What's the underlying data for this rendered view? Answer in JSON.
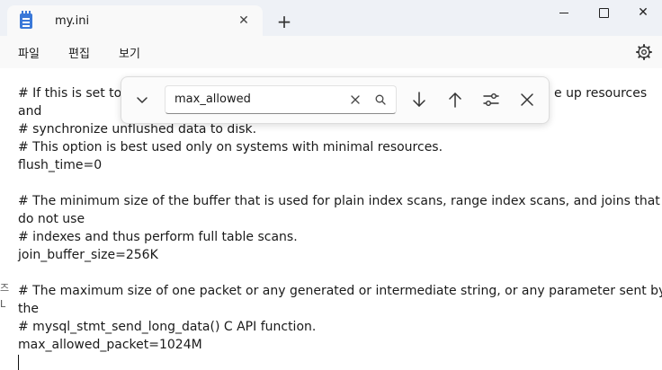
{
  "tab": {
    "title": "my.ini",
    "close_glyph": "✕"
  },
  "window": {
    "new_tab_glyph": "+",
    "close_glyph": "✕"
  },
  "menu": {
    "file": "파일",
    "edit": "편집",
    "view": "보기"
  },
  "find": {
    "query": "max_allowed"
  },
  "editor": {
    "lines": [
      "# If this is set to",
      "e up resources",
      "and",
      "# synchronize unflushed data to disk.",
      "# This option is best used only on systems with minimal resources.",
      "flush_time=0",
      "",
      "# The minimum size of the buffer that is used for plain index scans, range index scans, and joins that",
      "do not use",
      "# indexes and thus perform full table scans.",
      "join_buffer_size=256K",
      "",
      "# The maximum size of one packet or any generated or intermediate string, or any parameter sent by",
      "the",
      "# mysql_stmt_send_long_data() C API function.",
      "max_allowed_packet=1024M"
    ],
    "edge_fragments": [
      "즈",
      "L"
    ]
  },
  "icons": {
    "app": "notepad-icon",
    "settings": "gear-icon",
    "collapse": "chevron-down-icon",
    "clear": "close-icon",
    "search": "search-icon",
    "next": "arrow-down-icon",
    "previous": "arrow-up-icon",
    "options": "sliders-icon",
    "close_find": "close-icon"
  },
  "colors": {
    "titlebar": "#eef1f6",
    "tab": "#f9f9f9",
    "accent": "#3a78d8"
  }
}
